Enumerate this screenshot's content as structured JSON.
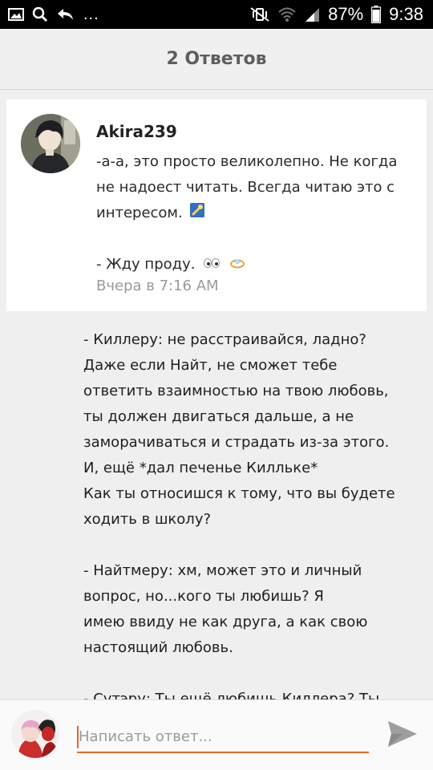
{
  "status_bar": {
    "icons_left": [
      "image-icon",
      "search-icon",
      "reply-arrow-icon"
    ],
    "overflow": "...",
    "icons_right": [
      "mute-vibrate-icon",
      "wifi-icon",
      "signal-icon"
    ],
    "battery": "87%",
    "time": "9:38"
  },
  "header": {
    "title": "2 Ответов"
  },
  "comment": {
    "author": "Akira239",
    "lines": [
      "-а-а, это просто великолепно. Не когда",
      "не надоест читать. Всегда читаю это с",
      "интересом."
    ],
    "line2": "- Жду проду.",
    "time": "Вчера в 7:16 AM"
  },
  "story": {
    "lines": [
      "- Киллеру: не расстраивайся, ладно?",
      "Даже если Найт, не сможет тебе",
      "ответить взаимностью на твою любовь,",
      "ты должен двигаться дальше, а не",
      "заморачиваться и страдать из-за этого.",
      "И, ещё *дал печенье Киллькe*",
      "Как ты относишся к тому, что вы будете",
      "ходить в школу?",
      "",
      "- Найтмеру: хм, может это и личный",
      "вопрос, но...кого ты любишь? Я",
      "имею ввиду не как друга, а как свою",
      "настоящий любовь.",
      "",
      "- Сутэру: Ты ещё любишь Киллера? Ты"
    ]
  },
  "reply": {
    "placeholder": "Написать ответ...",
    "send_icon": "send-icon"
  },
  "colors": {
    "accent": "#e8642c",
    "header_text": "#5e5e5e",
    "time_text": "#9a9a9a",
    "background": "#efefef"
  }
}
